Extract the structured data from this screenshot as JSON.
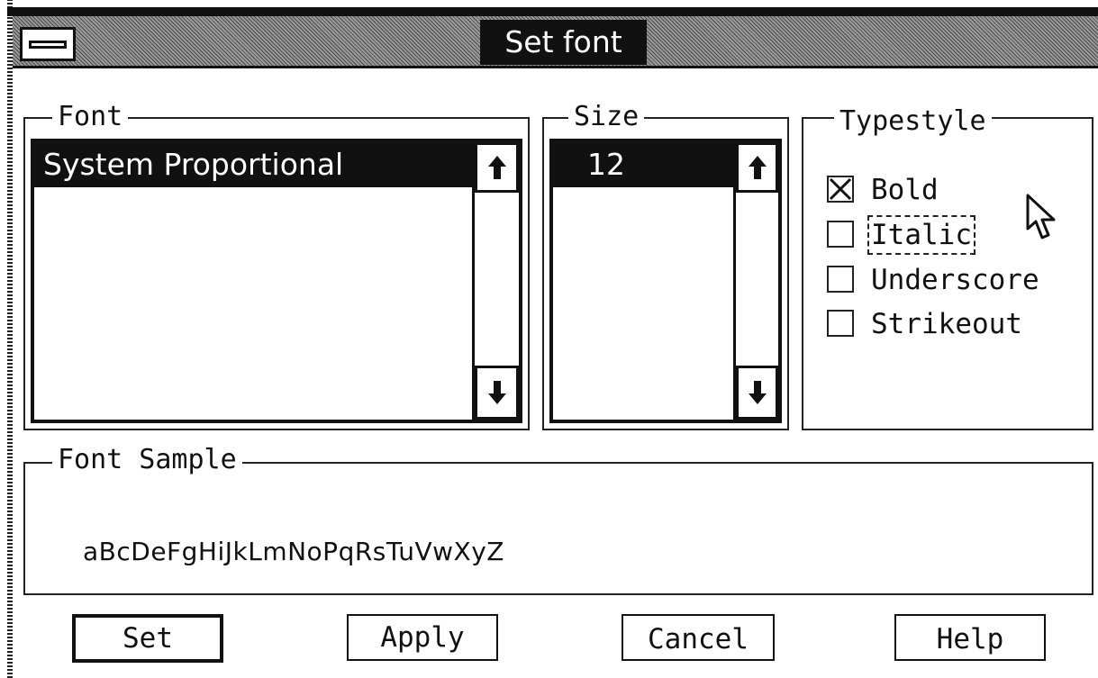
{
  "window": {
    "title": "Set font"
  },
  "font_group": {
    "label": "Font",
    "selected": "System Proportional"
  },
  "size_group": {
    "label": "Size",
    "selected": "12"
  },
  "typestyle": {
    "label": "Typestyle",
    "options": [
      {
        "label": "Bold",
        "checked": true
      },
      {
        "label": "Italic",
        "checked": false,
        "focused": true
      },
      {
        "label": "Underscore",
        "checked": false
      },
      {
        "label": "Strikeout",
        "checked": false
      }
    ]
  },
  "sample": {
    "label": "Font Sample",
    "text": "aBcDeFgHiJkLmNoPqRsTuVwXyZ"
  },
  "buttons": {
    "set": "Set",
    "apply": "Apply",
    "cancel": "Cancel",
    "help": "Help"
  },
  "icons": [
    "system-menu-icon",
    "scroll-up-arrow-icon",
    "scroll-down-arrow-icon",
    "mouse-pointer-icon"
  ]
}
